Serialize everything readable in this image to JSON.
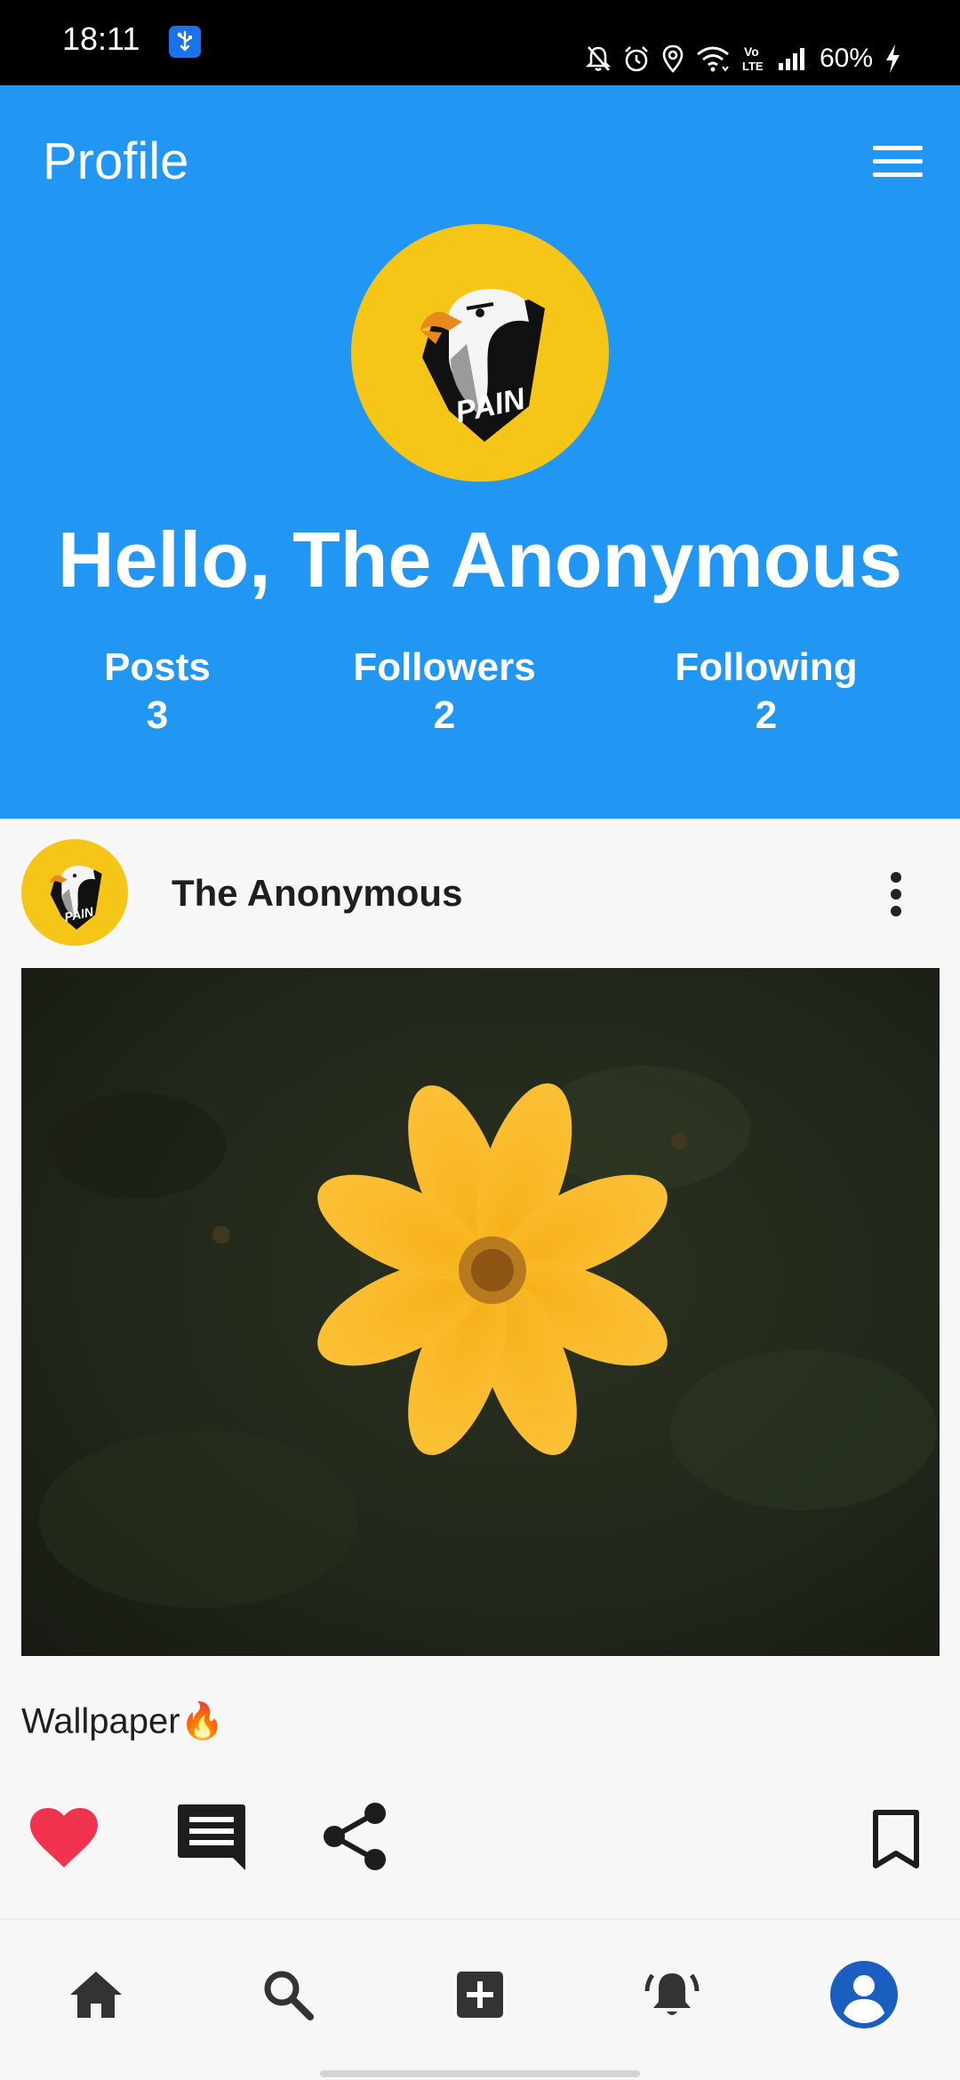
{
  "status_bar": {
    "time": "18:11",
    "battery": "60%",
    "icons": [
      "usb-icon",
      "mute-icon",
      "alarm-icon",
      "location-icon",
      "wifi-icon",
      "volte-icon",
      "signal-icon",
      "charging-icon"
    ],
    "volte_text": "Vo LTE"
  },
  "header": {
    "title": "Profile",
    "greeting": "Hello, The Anonymous",
    "background_color": "#2196f3",
    "logo_text": "PAIN",
    "stats": {
      "posts": {
        "label": "Posts",
        "value": "3"
      },
      "followers": {
        "label": "Followers",
        "value": "2"
      },
      "following": {
        "label": "Following",
        "value": "2"
      }
    }
  },
  "post": {
    "author": "The Anonymous",
    "caption": "Wallpaper🔥",
    "liked": true,
    "like_color": "#f2334f",
    "image_subject": "yellow-flower-photo"
  },
  "bottom_nav": {
    "items": [
      "home-icon",
      "search-icon",
      "add-post-icon",
      "notifications-icon",
      "profile-icon"
    ],
    "active": "profile-icon",
    "active_color": "#1a5fbf"
  }
}
